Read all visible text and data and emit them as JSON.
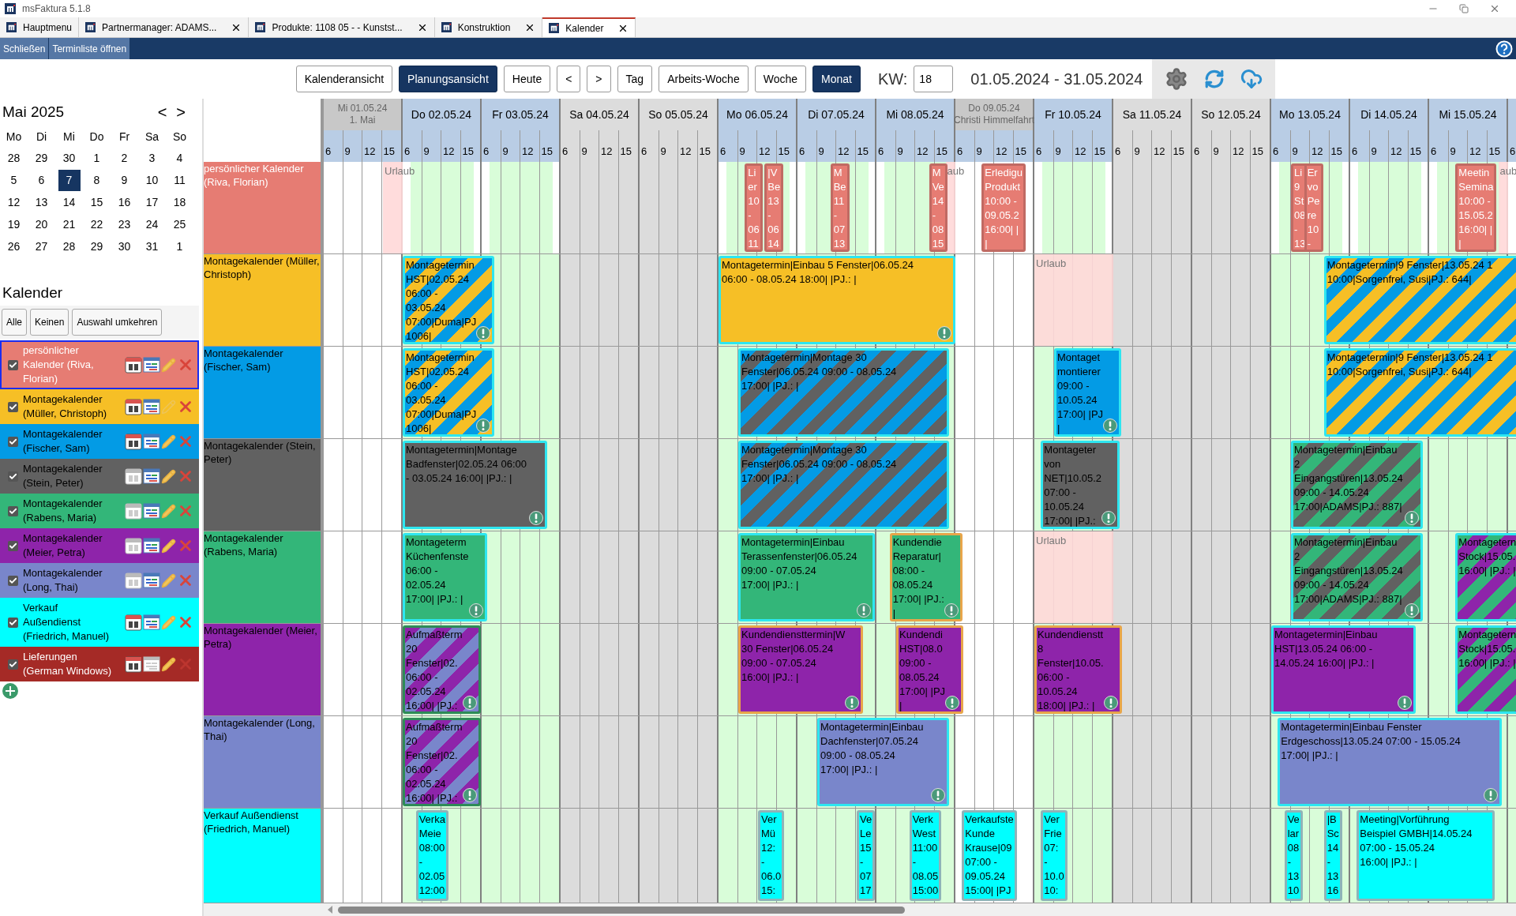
{
  "window": {
    "title": "msFaktura 5.1.8"
  },
  "tabs": [
    {
      "label": "Hauptmenu",
      "selected": false,
      "closable": false
    },
    {
      "label": "Partnermanager: ADAMS...",
      "selected": false,
      "closable": true
    },
    {
      "label": "Produkte: 1108 05 -  - Kunstst...",
      "selected": false,
      "closable": true
    },
    {
      "label": "Konstruktion",
      "selected": false,
      "closable": true
    },
    {
      "label": "Kalender",
      "selected": true,
      "closable": true
    }
  ],
  "action_bar": {
    "buttons": [
      "Schließen",
      "Terminliste öffnen"
    ]
  },
  "toolbar": {
    "view_buttons": [
      {
        "label": "Kalenderansicht",
        "selected": false
      },
      {
        "label": "Planungsansicht",
        "selected": true
      }
    ],
    "nav_buttons": [
      "Heute",
      "<",
      ">"
    ],
    "range_buttons": [
      {
        "label": "Tag",
        "selected": false
      },
      {
        "label": "Arbeits-Woche",
        "selected": false
      },
      {
        "label": "Woche",
        "selected": false
      },
      {
        "label": "Monat",
        "selected": true
      }
    ],
    "week_label": "KW:",
    "week_value": "18",
    "date_range": "01.05.2024 - 31.05.2024"
  },
  "mini_calendar": {
    "title": "Mai 2025",
    "prev": "<",
    "next": ">",
    "weekdays": [
      "Mo",
      "Di",
      "Mi",
      "Do",
      "Fr",
      "Sa",
      "So"
    ],
    "weeks": [
      [
        {
          "day": "28",
          "selected": false
        },
        {
          "day": "29",
          "selected": false
        },
        {
          "day": "30",
          "selected": false
        },
        {
          "day": "1",
          "selected": false
        },
        {
          "day": "2",
          "selected": false
        },
        {
          "day": "3",
          "selected": false
        },
        {
          "day": "4",
          "selected": false
        }
      ],
      [
        {
          "day": "5",
          "selected": false
        },
        {
          "day": "6",
          "selected": false
        },
        {
          "day": "7",
          "selected": true
        },
        {
          "day": "8",
          "selected": false
        },
        {
          "day": "9",
          "selected": false
        },
        {
          "day": "10",
          "selected": false
        },
        {
          "day": "11",
          "selected": false
        }
      ],
      [
        {
          "day": "12",
          "selected": false
        },
        {
          "day": "13",
          "selected": false
        },
        {
          "day": "14",
          "selected": false
        },
        {
          "day": "15",
          "selected": false
        },
        {
          "day": "16",
          "selected": false
        },
        {
          "day": "17",
          "selected": false
        },
        {
          "day": "18",
          "selected": false
        }
      ],
      [
        {
          "day": "19",
          "selected": false
        },
        {
          "day": "20",
          "selected": false
        },
        {
          "day": "21",
          "selected": false
        },
        {
          "day": "22",
          "selected": false
        },
        {
          "day": "23",
          "selected": false
        },
        {
          "day": "24",
          "selected": false
        },
        {
          "day": "25",
          "selected": false
        }
      ],
      [
        {
          "day": "26",
          "selected": false
        },
        {
          "day": "27",
          "selected": false
        },
        {
          "day": "28",
          "selected": false
        },
        {
          "day": "29",
          "selected": false
        },
        {
          "day": "30",
          "selected": false
        },
        {
          "day": "31",
          "selected": false
        },
        {
          "day": "1",
          "selected": false
        }
      ]
    ]
  },
  "calendars": {
    "title": "Kalender",
    "buttons": [
      "Alle",
      "Keinen",
      "Auswahl umkehren"
    ],
    "items": [
      {
        "label": "persönlicher Kalender (Riva, Florian)",
        "color": "#e67c73",
        "light_text": true,
        "checked": true,
        "selected": true,
        "sync_on": true,
        "list_on": true,
        "edit_on": true,
        "delete_on": true
      },
      {
        "label": "Montagekalender (Müller, Christoph)",
        "color": "#f6bf26",
        "light_text": false,
        "checked": true,
        "selected": false,
        "sync_on": true,
        "list_on": true,
        "edit_on": false,
        "delete_on": true
      },
      {
        "label": "Montagekalender (Fischer, Sam)",
        "color": "#039be5",
        "light_text": false,
        "checked": true,
        "selected": false,
        "sync_on": true,
        "list_on": true,
        "edit_on": true,
        "delete_on": true
      },
      {
        "label": "Montagekalender (Stein, Peter)",
        "color": "#616161",
        "light_text": false,
        "checked": true,
        "selected": false,
        "sync_on": false,
        "list_on": true,
        "edit_on": true,
        "delete_on": true
      },
      {
        "label": "Montagekalender (Rabens, Maria)",
        "color": "#33b679",
        "light_text": false,
        "checked": true,
        "selected": false,
        "sync_on": false,
        "list_on": true,
        "edit_on": true,
        "delete_on": true
      },
      {
        "label": "Montagekalender (Meier, Petra)",
        "color": "#8e24aa",
        "light_text": false,
        "checked": true,
        "selected": false,
        "sync_on": false,
        "list_on": true,
        "edit_on": true,
        "delete_on": true
      },
      {
        "label": "Montagekalender (Long, Thai)",
        "color": "#7986cb",
        "light_text": false,
        "checked": true,
        "selected": false,
        "sync_on": false,
        "list_on": true,
        "edit_on": true,
        "delete_on": true
      },
      {
        "label": "Verkauf Außendienst (Friedrich, Manuel)",
        "color": "#00ffff",
        "light_text": false,
        "checked": true,
        "selected": false,
        "sync_on": true,
        "list_on": true,
        "edit_on": true,
        "delete_on": true
      },
      {
        "label": "Lieferungen (German Windows)",
        "color": "#a52a26",
        "light_text": true,
        "checked": true,
        "selected": false,
        "sync_on": true,
        "list_on": false,
        "edit_on": true,
        "delete_on": false
      }
    ]
  },
  "planner": {
    "days": [
      {
        "label": "Mi 01.05.24",
        "holiday": "1. Mai",
        "kind": "holiday",
        "hours": [
          "6",
          "9",
          "12",
          "15"
        ]
      },
      {
        "label": "Do 02.05.24",
        "kind": "workday",
        "hours": [
          "6",
          "9",
          "12",
          "15"
        ]
      },
      {
        "label": "Fr 03.05.24",
        "kind": "workday",
        "hours": [
          "6",
          "9",
          "12",
          "15"
        ]
      },
      {
        "label": "Sa 04.05.24",
        "kind": "weekend",
        "hours": [
          "6",
          "9",
          "12",
          "15"
        ]
      },
      {
        "label": "So 05.05.24",
        "kind": "weekend",
        "hours": [
          "6",
          "9",
          "12",
          "15"
        ]
      },
      {
        "label": "Mo 06.05.24",
        "kind": "workday",
        "hours": [
          "6",
          "9",
          "12",
          "15"
        ]
      },
      {
        "label": "Di 07.05.24",
        "kind": "workday",
        "hours": [
          "6",
          "9",
          "12",
          "15"
        ]
      },
      {
        "label": "Mi 08.05.24",
        "kind": "workday",
        "hours": [
          "6",
          "9",
          "12",
          "15"
        ]
      },
      {
        "label": "Do 09.05.24",
        "holiday": "Christi Himmelfahrt",
        "kind": "holiday",
        "hours": [
          "6",
          "9",
          "12",
          "15"
        ]
      },
      {
        "label": "Fr 10.05.24",
        "kind": "workday",
        "hours": [
          "6",
          "9",
          "12",
          "15"
        ]
      },
      {
        "label": "Sa 11.05.24",
        "kind": "weekend",
        "hours": [
          "6",
          "9",
          "12",
          "15"
        ]
      },
      {
        "label": "So 12.05.24",
        "kind": "weekend",
        "hours": [
          "6",
          "9",
          "12",
          "15"
        ]
      },
      {
        "label": "Mo 13.05.24",
        "kind": "workday",
        "hours": [
          "6",
          "9",
          "12",
          "15"
        ]
      },
      {
        "label": "Di 14.05.24",
        "kind": "workday",
        "hours": [
          "6",
          "9",
          "12",
          "15"
        ]
      },
      {
        "label": "Mi 15.05.24",
        "kind": "workday",
        "hours": [
          "6",
          "9",
          "12",
          "15"
        ]
      },
      {
        "kind": "workday",
        "hours": [
          "6"
        ]
      }
    ],
    "rows": [
      {
        "label": "persönlicher Kalender (Riva, Florian)",
        "color": "#e67c73",
        "light_text": true,
        "kind": "office",
        "absences": [
          {
            "label": "Urlaub"
          },
          {
            "label": "aub"
          },
          {
            "label": "aub"
          }
        ],
        "events": [
          {
            "lines": [
              "Li",
              "er",
              "10",
              "-",
              "06",
              "11"
            ],
            "kind": "personal",
            "color": "#e67c73",
            "alert": false
          },
          {
            "lines": [
              "|V",
              "Be",
              "13",
              "-",
              "06",
              "14"
            ],
            "kind": "personal",
            "color": "#e67c73",
            "alert": false
          },
          {
            "lines": [
              "M",
              "Be",
              "11",
              "-",
              "07",
              "13"
            ],
            "kind": "personal",
            "color": "#e67c73",
            "alert": false
          },
          {
            "lines": [
              "M",
              "Ve",
              "14",
              "-",
              "08",
              "15"
            ],
            "kind": "personal",
            "color": "#e67c73",
            "alert": false
          },
          {
            "lines": [
              "Erledigu",
              "Produkt",
              "10:00 -",
              "09.05.2",
              "16:00| |",
              "|"
            ],
            "kind": "personal",
            "color": "#e67c73",
            "alert": false
          },
          {
            "lines": [
              "Li",
              "9",
              "St",
              "08",
              "-",
              "13"
            ],
            "kind": "personal",
            "color": "#e67c73",
            "alert": false
          },
          {
            "lines": [
              "Er",
              "vo",
              "Pe",
              "re",
              "10",
              "-"
            ],
            "kind": "personal",
            "color": "#e67c73",
            "alert": false
          },
          {
            "lines": [
              "Meetin",
              "Semina",
              "10:00 -",
              "15.05.2",
              "16:00| |",
              "|"
            ],
            "kind": "personal",
            "color": "#e67c73",
            "alert": false
          }
        ]
      },
      {
        "label": "Montagekalender (Müller, Christoph)",
        "color": "#f6bf26",
        "light_text": false,
        "kind": "field",
        "absences": [
          {
            "label": "Urlaub"
          }
        ],
        "events": [
          {
            "lines": [
              "Montagetermin",
              "HST|02.05.24",
              "06:00 -",
              "03.05.24",
              "07:00|Duma|PJ",
              "1006|"
            ],
            "kind": "montage",
            "color": "#f6bf26",
            "stripe": {
              "color": "#039be5"
            },
            "alert": true
          },
          {
            "lines": [
              "Montagetermin|Einbau 5 Fenster|06.05.24",
              "06:00 - 08.05.24 18:00| |PJ.: |"
            ],
            "kind": "montage",
            "color": "#f6bf26",
            "alert": true
          },
          {
            "lines": [
              "Montagetermin|9 Fenster|13.05.24 1",
              "10:00|Sorgenfrei, Susi|PJ.: 644|"
            ],
            "kind": "montage",
            "color": "#039be5",
            "stripe": {
              "color": "#f6bf26"
            },
            "alert": false
          }
        ]
      },
      {
        "label": "Montagekalender (Fischer, Sam)",
        "color": "#039be5",
        "light_text": false,
        "kind": "field",
        "absences": [],
        "events": [
          {
            "lines": [
              "Montagetermin",
              "HST|02.05.24",
              "06:00 -",
              "03.05.24",
              "07:00|Duma|PJ",
              "1006|"
            ],
            "kind": "montage",
            "color": "#f6bf26",
            "stripe": {
              "color": "#039be5"
            },
            "alert": true
          },
          {
            "lines": [
              "Montagetermin|Montage 30",
              "Fenster|06.05.24 09:00 - 08.05.24",
              "17:00| |PJ.: |"
            ],
            "kind": "montage",
            "color": "#039be5",
            "stripe": {
              "color": "#616161"
            },
            "alert": false
          },
          {
            "lines": [
              "Montaget",
              "montierer",
              "09:00 -",
              "10.05.24",
              "17:00| |PJ",
              "|"
            ],
            "kind": "montage",
            "color": "#039be5",
            "alert": true
          },
          {
            "lines": [
              "Montagetermin|9 Fenster|13.05.24 1",
              "10:00|Sorgenfrei, Susi|PJ.: 644|"
            ],
            "kind": "montage",
            "color": "#039be5",
            "stripe": {
              "color": "#f6bf26"
            },
            "alert": false
          }
        ]
      },
      {
        "label": "Montagekalender (Stein, Peter)",
        "color": "#616161",
        "light_text": false,
        "kind": "field",
        "absences": [],
        "events": [
          {
            "lines": [
              "Montagetermin|Montage",
              "Badfenster|02.05.24 06:00",
              "- 03.05.24 16:00| |PJ.: |"
            ],
            "kind": "montage",
            "color": "#616161",
            "alert": true
          },
          {
            "lines": [
              "Montagetermin|Montage 30",
              "Fenster|06.05.24 09:00 - 08.05.24",
              "17:00| |PJ.: |"
            ],
            "kind": "montage",
            "color": "#039be5",
            "stripe": {
              "color": "#616161"
            },
            "alert": false
          },
          {
            "lines": [
              "Montageter",
              "von",
              "NET|10.05.2",
              "07:00 -",
              "10.05.24",
              "17:00| |PJ.:"
            ],
            "kind": "montage",
            "color": "#616161",
            "alert": true
          },
          {
            "lines": [
              "Montagetermin|Einbau",
              "2",
              "Eingangstüren|13.05.24",
              "09:00 - 14.05.24",
              "17:00|ADAMS|PJ.: 887|"
            ],
            "kind": "montage",
            "color": "#33b679",
            "stripe": {
              "color": "#616161"
            },
            "alert": true
          }
        ]
      },
      {
        "label": "Montagekalender (Rabens, Maria)",
        "color": "#33b679",
        "light_text": false,
        "kind": "field",
        "absences": [
          {
            "label": "Urlaub"
          }
        ],
        "events": [
          {
            "lines": [
              "Montageterm",
              "Küchenfenste",
              "06:00 -",
              "02.05.24",
              "17:00| |PJ.: |"
            ],
            "kind": "montage",
            "color": "#33b679",
            "alert": true
          },
          {
            "lines": [
              "Montagetermin|Einbau",
              "Terassenfenster|06.05.24",
              "09:00 - 07.05.24",
              "17:00| |PJ.: |"
            ],
            "kind": "montage",
            "color": "#33b679",
            "alert": true
          },
          {
            "lines": [
              "Kundendie",
              "Reparatur|",
              "08:00 -",
              "08.05.24",
              "17:00| |PJ.:",
              "|"
            ],
            "kind": "service",
            "color": "#33b679",
            "alert": true
          },
          {
            "lines": [
              "Montagetermin|Einbau",
              "2",
              "Eingangstüren|13.05.24",
              "09:00 - 14.05.24",
              "17:00|ADAMS|PJ.: 887|"
            ],
            "kind": "montage",
            "color": "#33b679",
            "stripe": {
              "color": "#616161"
            },
            "alert": true
          },
          {
            "lines": [
              "Montagetern",
              "Stock|15.05.",
              "16:00| |PJ.: |"
            ],
            "kind": "montage",
            "color": "#33b679",
            "stripe": {
              "color": "#8e24aa"
            },
            "alert": false
          }
        ]
      },
      {
        "label": "Montagekalender (Meier, Petra)",
        "color": "#8e24aa",
        "light_text": false,
        "kind": "field",
        "absences": [],
        "events": [
          {
            "lines": [
              "Aufmaßterm",
              "20",
              "Fenster|02.",
              "06:00 -",
              "02.05.24",
              "16:00| |PJ.:"
            ],
            "kind": "survey",
            "color": "#8e24aa",
            "stripe": {
              "color": "#7986cb"
            },
            "alert": true
          },
          {
            "lines": [
              "Kundendiensttermin|W",
              "30 Fenster|06.05.24",
              "09:00 - 07.05.24",
              "16:00| |PJ.: |"
            ],
            "kind": "service",
            "color": "#8e24aa",
            "alert": true
          },
          {
            "lines": [
              "Kundendi",
              "HST|08.0",
              "09:00 -",
              "08.05.24",
              "17:00| |PJ",
              "|"
            ],
            "kind": "service",
            "color": "#8e24aa",
            "alert": true
          },
          {
            "lines": [
              "Kundendienstt",
              "8",
              "Fenster|10.05.",
              "06:00 -",
              "10.05.24",
              "18:00| |PJ.: |"
            ],
            "kind": "service",
            "color": "#8e24aa",
            "alert": true
          },
          {
            "lines": [
              "Montagetermin|Einbau",
              "HST|13.05.24 06:00 -",
              "14.05.24 16:00| |PJ.: |"
            ],
            "kind": "montage",
            "color": "#8e24aa",
            "alert": true
          },
          {
            "lines": [
              "Montagetern",
              "Stock|15.05.",
              "16:00| |PJ.: |"
            ],
            "kind": "montage",
            "color": "#33b679",
            "stripe": {
              "color": "#8e24aa"
            },
            "alert": false
          }
        ]
      },
      {
        "label": "Montagekalender (Long, Thai)",
        "color": "#7986cb",
        "light_text": false,
        "kind": "field",
        "absences": [],
        "events": [
          {
            "lines": [
              "Aufmaßterm",
              "20",
              "Fenster|02.",
              "06:00 -",
              "02.05.24",
              "16:00| |PJ.:"
            ],
            "kind": "survey",
            "color": "#8e24aa",
            "stripe": {
              "color": "#7986cb"
            },
            "alert": true
          },
          {
            "lines": [
              "Montagetermin|Einbau",
              "Dachfenster|07.05.24",
              "09:00 - 08.05.24",
              "17:00| |PJ.: |"
            ],
            "kind": "montage",
            "color": "#7986cb",
            "alert": true
          },
          {
            "lines": [
              "Montagetermin|Einbau Fenster",
              "Erdgeschoss|13.05.24 07:00 - 15.05.24",
              "17:00| |PJ.: |"
            ],
            "kind": "montage",
            "color": "#7986cb",
            "alert": true
          }
        ]
      },
      {
        "label": "Verkauf Außendienst (Friedrich, Manuel)",
        "color": "#00ffff",
        "light_text": false,
        "kind": "field",
        "absences": [],
        "events": [
          {
            "lines": [
              "Verka",
              "Meie",
              "08:00",
              "-",
              "02.05",
              "12:00"
            ],
            "kind": "sales",
            "color": "#00ffff",
            "alert": false
          },
          {
            "lines": [
              "Ver",
              "Mü",
              "12:",
              "-",
              "06.0",
              "15:"
            ],
            "kind": "sales",
            "color": "#00ffff",
            "alert": false
          },
          {
            "lines": [
              "Ve",
              "Le",
              "15",
              "-",
              "07",
              "17"
            ],
            "kind": "sales",
            "color": "#00ffff",
            "alert": false
          },
          {
            "lines": [
              "Verk",
              "West",
              "11:00",
              "-",
              "08.05",
              "15:00"
            ],
            "kind": "sales",
            "color": "#00ffff",
            "alert": false
          },
          {
            "lines": [
              "Verkaufste",
              "Kunde",
              "Krause|09",
              "07:00 -",
              "09.05.24",
              "15:00| |PJ"
            ],
            "kind": "sales",
            "color": "#00ffff",
            "alert": false
          },
          {
            "lines": [
              "Ver",
              "Frie",
              "07:",
              "-",
              "10.0",
              "10:"
            ],
            "kind": "sales",
            "color": "#00ffff",
            "alert": false
          },
          {
            "lines": [
              "Ve",
              "lar",
              "08",
              "-",
              "13",
              "10"
            ],
            "kind": "sales",
            "color": "#00ffff",
            "alert": false
          },
          {
            "lines": [
              "|B",
              "Sc",
              "14",
              "-",
              "13",
              "16"
            ],
            "kind": "sales",
            "color": "#00ffff",
            "alert": false
          },
          {
            "lines": [
              "Meeting|Vorführung",
              "Beispiel GMBH|14.05.24",
              "07:00 - 15.05.24",
              "16:00| |PJ.: |"
            ],
            "kind": "sales",
            "color": "#00ffff",
            "alert": false
          }
        ]
      }
    ]
  }
}
